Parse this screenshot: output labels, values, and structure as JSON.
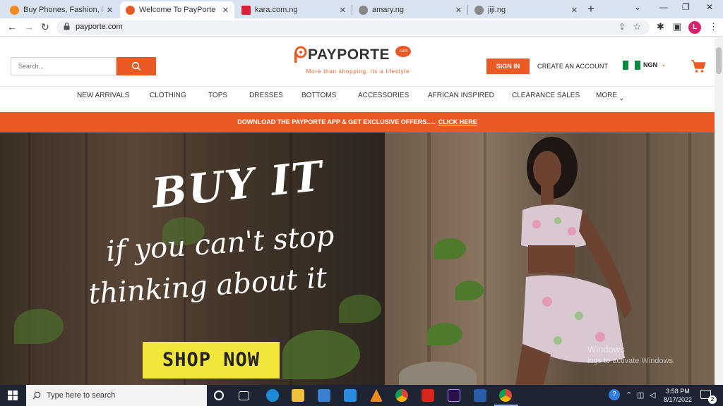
{
  "browser": {
    "tabs": [
      {
        "title": "Buy Phones, Fashion, Electro",
        "favicon_color": "#f68b1e",
        "active": false
      },
      {
        "title": "Welcome To PayPorte Fashio",
        "favicon_color": "#e95a24",
        "active": true
      },
      {
        "title": "kara.com.ng",
        "favicon_color": "#d8223b",
        "active": false
      },
      {
        "title": "amary.ng",
        "favicon_color": "#888888",
        "active": false
      },
      {
        "title": "jiji.ng",
        "favicon_color": "#888888",
        "active": false
      }
    ],
    "close_glyph": "✕",
    "new_tab_glyph": "+",
    "url": "payporte.com",
    "profile_initial": "L"
  },
  "site": {
    "search_placeholder": "Search...",
    "logo_text": "PAYPORTE",
    "logo_com": ".com",
    "logo_tagline": "More than shopping, its a lifestyle",
    "signin_label": "SIGN IN",
    "create_account_label": "CREATE AN ACCOUNT",
    "currency": "NGN",
    "categories": [
      "NEW ARRIVALS",
      "CLOTHING",
      "TOPS",
      "DRESSES",
      "BOTTOMS",
      "ACCESSORIES",
      "AFRICAN INSPIRED",
      "CLEARANCE SALES",
      "MORE"
    ],
    "promo_text": "DOWNLOAD THE PAYPORTE APP & GET EXCLUSIVE OFFERS.....",
    "promo_link": "CLICK HERE",
    "brand_color": "#e95a24"
  },
  "hero": {
    "headline": "BUY IT",
    "subline1": "if you can't stop",
    "subline2": "thinking about it",
    "cta": "SHOP NOW",
    "watermark1": "Windows",
    "watermark2": "ings to activate Windows."
  },
  "taskbar": {
    "search_placeholder": "Type here to search",
    "time": "3:58 PM",
    "date": "8/17/2022",
    "notification_count": "2"
  }
}
